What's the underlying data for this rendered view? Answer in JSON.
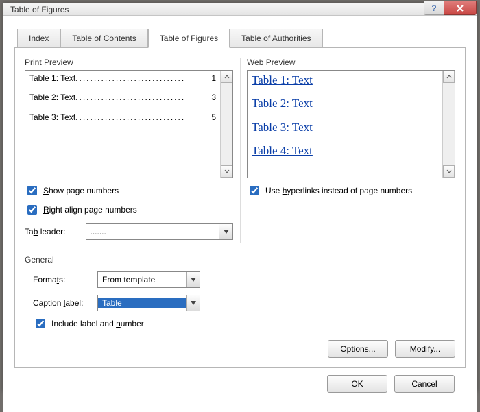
{
  "title": "Table of Figures",
  "tabs": {
    "index": "Index",
    "toc": "Table of Contents",
    "tof": "Table of Figures",
    "toa": "Table of Authorities"
  },
  "print": {
    "label": "Print Preview",
    "rows": [
      {
        "label": "Table 1: Text",
        "page": "1"
      },
      {
        "label": "Table 2: Text",
        "page": "3"
      },
      {
        "label": "Table 3: Text",
        "page": "5"
      }
    ]
  },
  "web": {
    "label": "Web Preview",
    "rows": [
      "Table 1: Text",
      "Table 2: Text",
      "Table 3: Text",
      "Table 4: Text"
    ]
  },
  "opts": {
    "show_page": "Show page numbers",
    "right_align": "Right align page numbers",
    "hyperlinks": "Use hyperlinks instead of page numbers",
    "tab_leader_label": "Tab leader:",
    "tab_leader_value": "......."
  },
  "general": {
    "title": "General",
    "formats_label": "Formats:",
    "formats_value": "From template",
    "caption_label": "Caption label:",
    "caption_value": "Table",
    "include": "Include label and number"
  },
  "buttons": {
    "options": "Options...",
    "modify": "Modify...",
    "ok": "OK",
    "cancel": "Cancel"
  }
}
